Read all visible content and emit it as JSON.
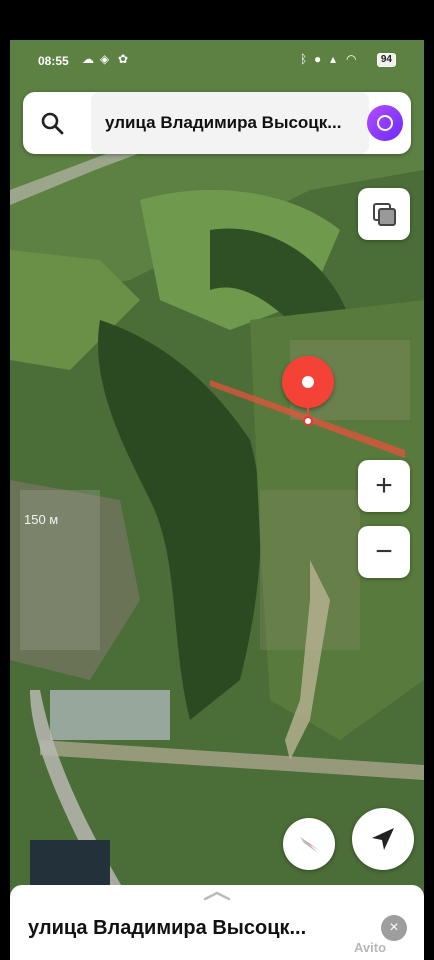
{
  "status_bar": {
    "time": "08:55",
    "battery": "94"
  },
  "search": {
    "query": "улица Владимира Высоцк..."
  },
  "map": {
    "scale_label": "150 м"
  },
  "card": {
    "title": "улица Владимира Высоцк...",
    "close_symbol": "×"
  },
  "controls": {
    "zoom_in": "+",
    "zoom_out": "−"
  },
  "watermark": "Avito",
  "colors": {
    "pin": "#f44336",
    "route": "#e5533d",
    "alice": "#8a3cff"
  }
}
